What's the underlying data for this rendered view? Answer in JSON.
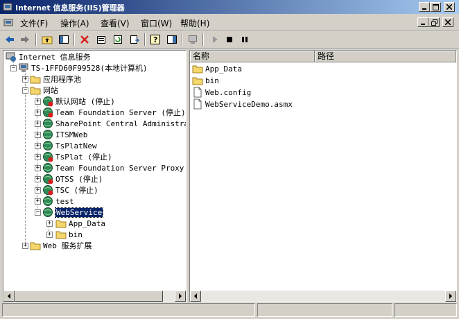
{
  "window": {
    "title": "Internet 信息服务(IIS)管理器"
  },
  "menu": [
    "文件(F)",
    "操作(A)",
    "查看(V)",
    "窗口(W)",
    "帮助(H)"
  ],
  "tree": {
    "root": "Internet 信息服务",
    "computer": "TS-1FFD60F99528(本地计算机)",
    "app_pools": "应用程序池",
    "websites": "网站",
    "sites": [
      "默认网站 (停止)",
      "Team Foundation Server (停止)",
      "SharePoint Central Administrat",
      "ITSMWeb",
      "TsPlatNew",
      "TsPlat (停止)",
      "Team Foundation Server Proxy",
      "OTSS (停止)",
      "TSC (停止)",
      "test",
      "WebService"
    ],
    "webservice_children": [
      "App_Data",
      "bin"
    ],
    "web_ext": "Web 服务扩展"
  },
  "list": {
    "columns": [
      "名称",
      "路径"
    ],
    "items": [
      {
        "name": "App_Data",
        "icon": "folder-icon"
      },
      {
        "name": "bin",
        "icon": "folder-icon"
      },
      {
        "name": "Web.config",
        "icon": "document-icon"
      },
      {
        "name": "WebServiceDemo.asmx",
        "icon": "document-icon"
      }
    ]
  },
  "colors": {
    "title_start": "#0a246a",
    "title_end": "#a6caf0",
    "selection": "#0a246a",
    "face": "#d4d0c8"
  }
}
